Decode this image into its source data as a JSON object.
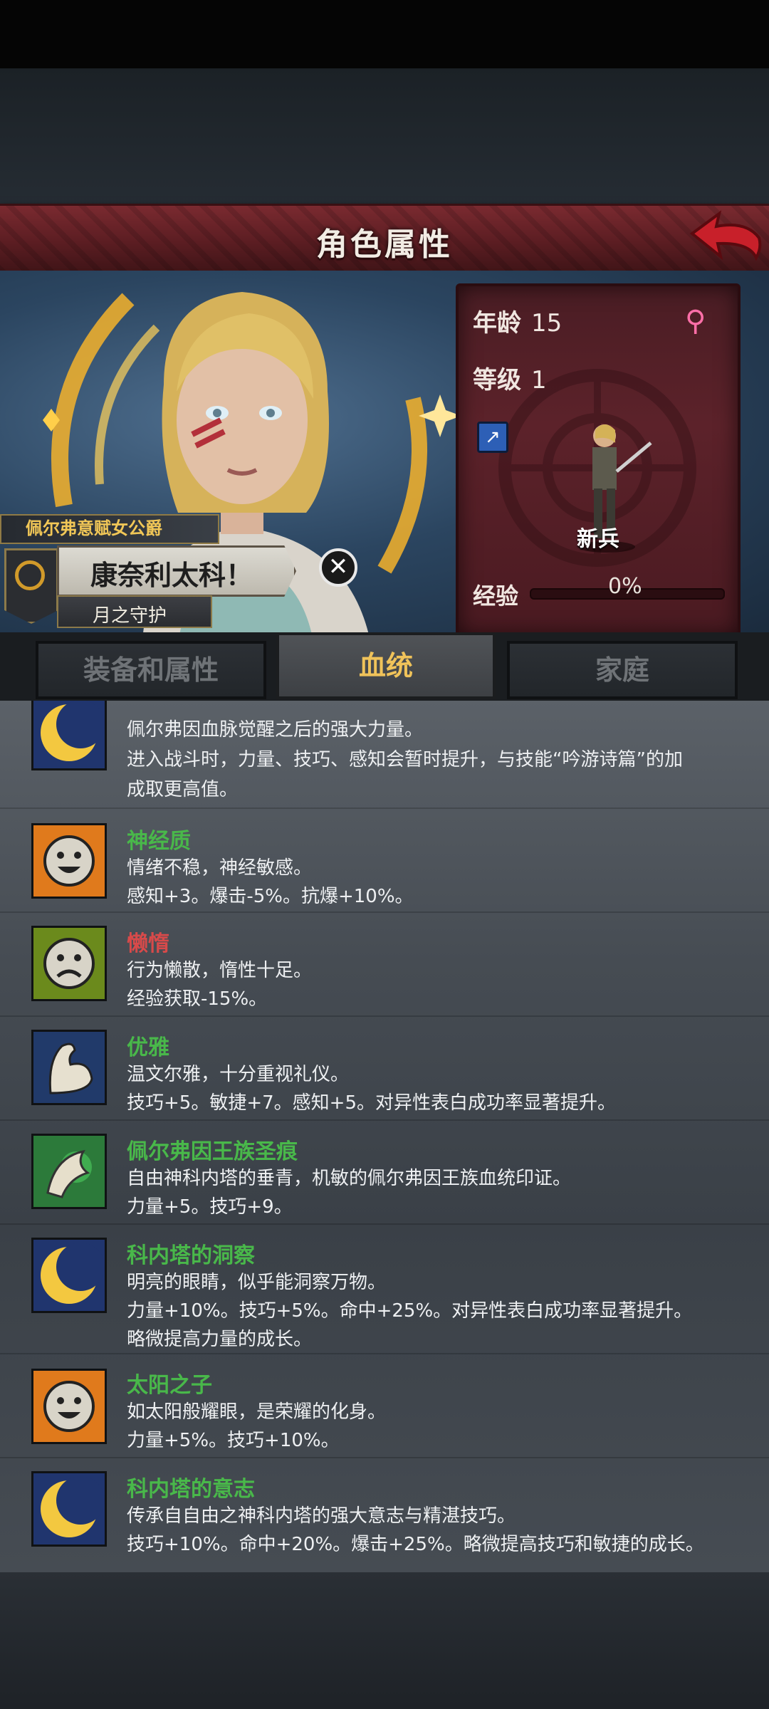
{
  "header": {
    "title": "角色属性"
  },
  "stats": {
    "age_label": "年龄",
    "age_value": "15",
    "level_label": "等级",
    "level_value": "1",
    "rank": "新兵",
    "exp_label": "经验",
    "exp_value": "0%",
    "exp_progress": 0
  },
  "character": {
    "title": "佩尔弗意赋女公爵",
    "name": "康奈利太科！",
    "blessing": "月之守护"
  },
  "tabs": [
    {
      "label": "装备和属性",
      "active": false
    },
    {
      "label": "血统",
      "active": true
    },
    {
      "label": "家庭",
      "active": false
    }
  ],
  "traits": [
    {
      "name": "",
      "icon": "moon-icon",
      "lines": [
        "佩尔弗因血脉觉醒之后的强大力量。",
        "进入战斗时，力量、技巧、感知会暂时提升，与技能“吟游诗篇”的加",
        "成取更高值。"
      ]
    },
    {
      "name": "神经质",
      "icon": "happy-face-icon",
      "lines": [
        "情绪不稳，神经敏感。",
        "感知+3。爆击-5%。抗爆+10%。"
      ]
    },
    {
      "name": "懒惰",
      "icon": "sad-face-icon",
      "lines": [
        "行为懒散，惰性十足。",
        "经验获取-15%。"
      ]
    },
    {
      "name": "优雅",
      "icon": "arm-icon",
      "lines": [
        "温文尔雅，十分重视礼仪。",
        "技巧+5。敏捷+7。感知+5。对异性表白成功率显著提升。"
      ]
    },
    {
      "name": "佩尔弗因王族圣痕",
      "icon": "feather-icon",
      "lines": [
        "自由神科内塔的垂青，机敏的佩尔弗因王族血统印证。",
        "力量+5。技巧+9。"
      ]
    },
    {
      "name": "科内塔的洞察",
      "icon": "moon-icon",
      "lines": [
        "明亮的眼睛，似乎能洞察万物。",
        "力量+10%。技巧+5%。命中+25%。对异性表白成功率显著提升。",
        "略微提高力量的成长。"
      ]
    },
    {
      "name": "太阳之子",
      "icon": "happy-face-icon",
      "lines": [
        "如太阳般耀眼，是荣耀的化身。",
        "力量+5%。技巧+10%。"
      ]
    },
    {
      "name": "科内塔的意志",
      "icon": "moon-icon",
      "lines": [
        "传承自自由之神科内塔的强大意志与精湛技巧。",
        "技巧+10%。命中+20%。爆击+25%。略微提高技巧和敏捷的成长。"
      ]
    }
  ]
}
